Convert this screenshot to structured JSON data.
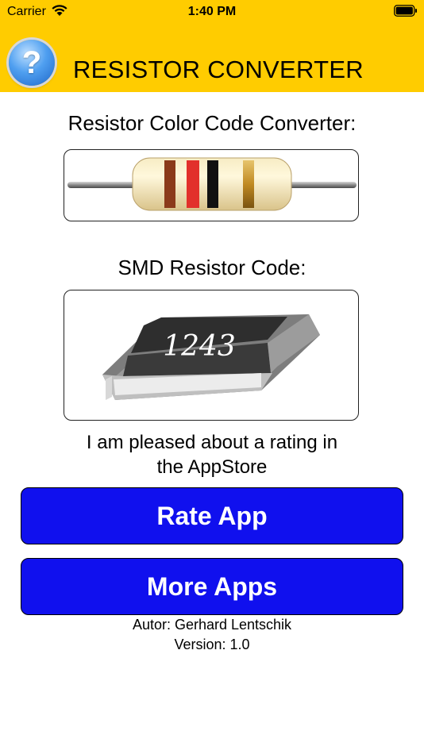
{
  "status_bar": {
    "carrier": "Carrier",
    "time": "1:40 PM"
  },
  "header": {
    "help_symbol": "?",
    "title": "RESISTOR CONVERTER",
    "background_color": "#ffcc00"
  },
  "color_code_section": {
    "title": "Resistor Color Code Converter:"
  },
  "smd_section": {
    "title": "SMD Resistor Code:",
    "code": "1243"
  },
  "rating_message": {
    "line1": "I am pleased about a rating in",
    "line2": "the AppStore"
  },
  "buttons": {
    "rate_app": "Rate App",
    "more_apps": "More Apps",
    "button_color": "#1010ee"
  },
  "footer": {
    "author": "Autor: Gerhard Lentschik",
    "version": "Version: 1.0"
  }
}
